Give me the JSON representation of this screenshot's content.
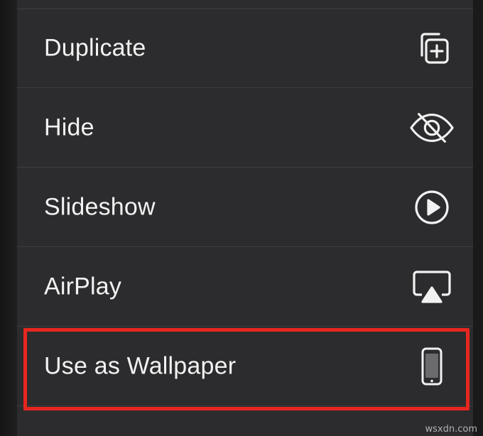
{
  "menu": {
    "items": [
      {
        "label": "Duplicate",
        "icon": "duplicate-icon"
      },
      {
        "label": "Hide",
        "icon": "eye-slash-icon"
      },
      {
        "label": "Slideshow",
        "icon": "play-circle-icon"
      },
      {
        "label": "AirPlay",
        "icon": "airplay-icon"
      },
      {
        "label": "Use as Wallpaper",
        "icon": "iphone-icon"
      }
    ],
    "highlighted_item_index": 4
  },
  "colors": {
    "menu_background": "#2c2c2e",
    "text": "#f2f2f2",
    "separator": "#3d3d3f",
    "highlight_border": "#e8261f"
  },
  "watermark": "wsxdn.com"
}
